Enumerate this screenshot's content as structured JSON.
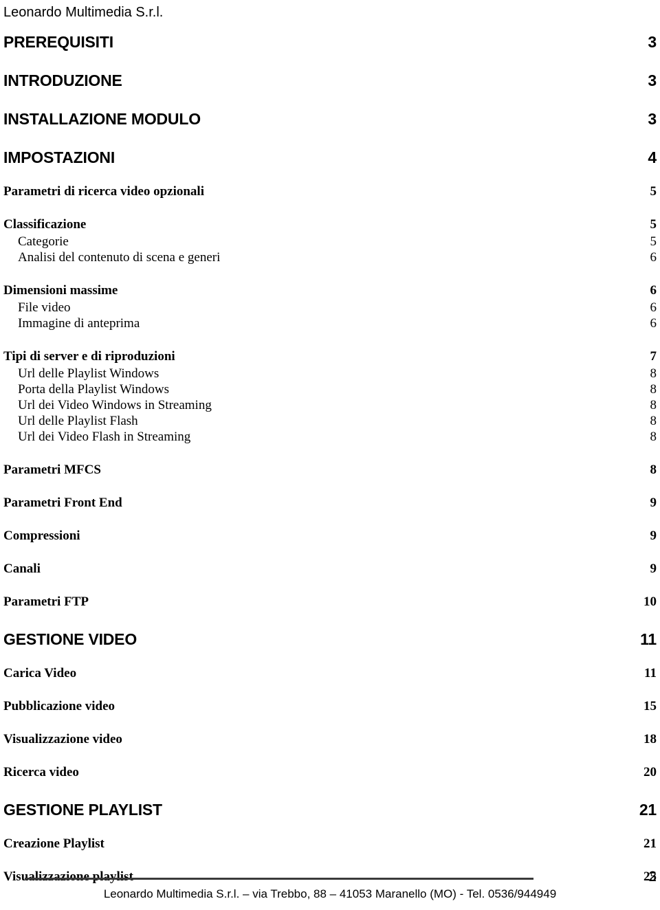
{
  "header": {
    "company": "Leonardo Multimedia S.r.l."
  },
  "toc": {
    "entries": [
      {
        "level": 1,
        "label": "PREREQUISITI",
        "page": "3"
      },
      {
        "level": 1,
        "label": "INTRODUZIONE",
        "page": "3"
      },
      {
        "level": 1,
        "label": "INSTALLAZIONE MODULO",
        "page": "3"
      },
      {
        "level": 1,
        "label": "IMPOSTAZIONI",
        "page": "4"
      },
      {
        "level": 2,
        "label": "Parametri di ricerca video opzionali",
        "page": "5"
      },
      {
        "level": 2,
        "label": "Classificazione",
        "page": "5"
      },
      {
        "level": 3,
        "label": "Categorie",
        "page": "5"
      },
      {
        "level": 3,
        "label": "Analisi del contenuto di scena e generi",
        "page": "6"
      },
      {
        "level": 2,
        "label": "Dimensioni massime",
        "page": "6"
      },
      {
        "level": 3,
        "label": "File video",
        "page": "6"
      },
      {
        "level": 3,
        "label": "Immagine di anteprima",
        "page": "6"
      },
      {
        "level": 2,
        "label": "Tipi di server e di riproduzioni",
        "page": "7"
      },
      {
        "level": 3,
        "label": "Url delle Playlist Windows",
        "page": "8"
      },
      {
        "level": 3,
        "label": "Porta della Playlist Windows",
        "page": "8"
      },
      {
        "level": 3,
        "label": "Url dei Video Windows in Streaming",
        "page": "8"
      },
      {
        "level": 3,
        "label": "Url delle Playlist Flash",
        "page": "8"
      },
      {
        "level": 3,
        "label": "Url dei Video Flash in Streaming",
        "page": "8"
      },
      {
        "level": 2,
        "label": "Parametri MFCS",
        "page": "8"
      },
      {
        "level": 2,
        "label": "Parametri Front End",
        "page": "9"
      },
      {
        "level": 2,
        "label": "Compressioni",
        "page": "9"
      },
      {
        "level": 2,
        "label": "Canali",
        "page": "9"
      },
      {
        "level": 2,
        "label": "Parametri FTP",
        "page": "10"
      },
      {
        "level": 1,
        "label": "GESTIONE VIDEO",
        "page": "11"
      },
      {
        "level": 2,
        "label": "Carica Video",
        "page": "11"
      },
      {
        "level": 2,
        "label": "Pubblicazione video",
        "page": "15"
      },
      {
        "level": 2,
        "label": "Visualizzazione video",
        "page": "18"
      },
      {
        "level": 2,
        "label": "Ricerca video",
        "page": "20"
      },
      {
        "level": 1,
        "label": "GESTIONE PLAYLIST",
        "page": "21"
      },
      {
        "level": 2,
        "label": "Creazione Playlist",
        "page": "21"
      },
      {
        "level": 2,
        "label": "Visualizzazione playlist",
        "page": "25"
      }
    ]
  },
  "footer": {
    "page_number": "2",
    "text": "Leonardo Multimedia S.r.l. – via Trebbo, 88 – 41053 Maranello (MO) - Tel. 0536/944949"
  }
}
